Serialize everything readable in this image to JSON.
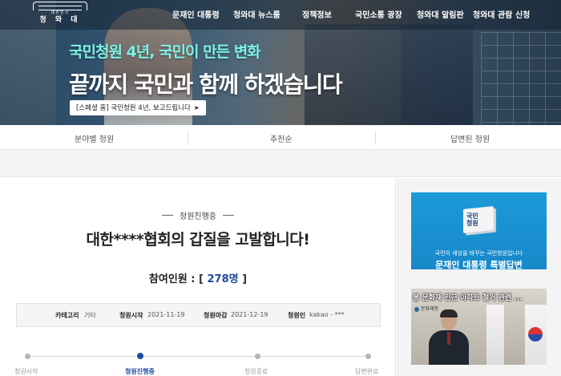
{
  "header": {
    "logo_small": "대한민국",
    "logo_name": "청 와 대",
    "nav": [
      "문재인 대통령",
      "청와대 뉴스룸",
      "정책정보",
      "국민소통 광장",
      "청와대 알림판",
      "청와대 관람 신청"
    ]
  },
  "hero": {
    "subtitle": "국민청원 4년, 국민이 만든 변화",
    "title": "끝까지 국민과 함께 하겠습니다",
    "button": "[스페셜 홈] 국민청원 4년, 보고드립니다"
  },
  "tabs": [
    "분야별 청원",
    "추천순",
    "답변된 청원"
  ],
  "petition": {
    "status": "청원진행중",
    "title": "대한****협회의 갑질을 고발합니다!",
    "count_label": "참여인원 : ",
    "count_value": "278명",
    "bracket_open": "[ ",
    "bracket_close": " ]",
    "info": {
      "category_label": "카테고리",
      "category_value": "기타",
      "start_label": "청원시작",
      "start_value": "2021-11-19",
      "end_label": "청원마감",
      "end_value": "2021-12-19",
      "author_label": "청원인",
      "author_value": "kakao - ***"
    },
    "steps": [
      "청원시작",
      "청원진행중",
      "청원종료",
      "답변완료"
    ],
    "active_step": 1
  },
  "side": {
    "banner_box_text": "국민\n청원",
    "banner_line1": "국민이 세상을 바꾸는 국민청원입니다",
    "banner_line2": "문재인 대통령 특별답변",
    "video_caption": "봉 문화재 인근 아파트 철거 관련 ...",
    "video_org": "문화재청"
  },
  "colors": {
    "accent": "#1f4a9c",
    "hero_sub": "#7df3e8",
    "banner": "#1d9ad8"
  }
}
